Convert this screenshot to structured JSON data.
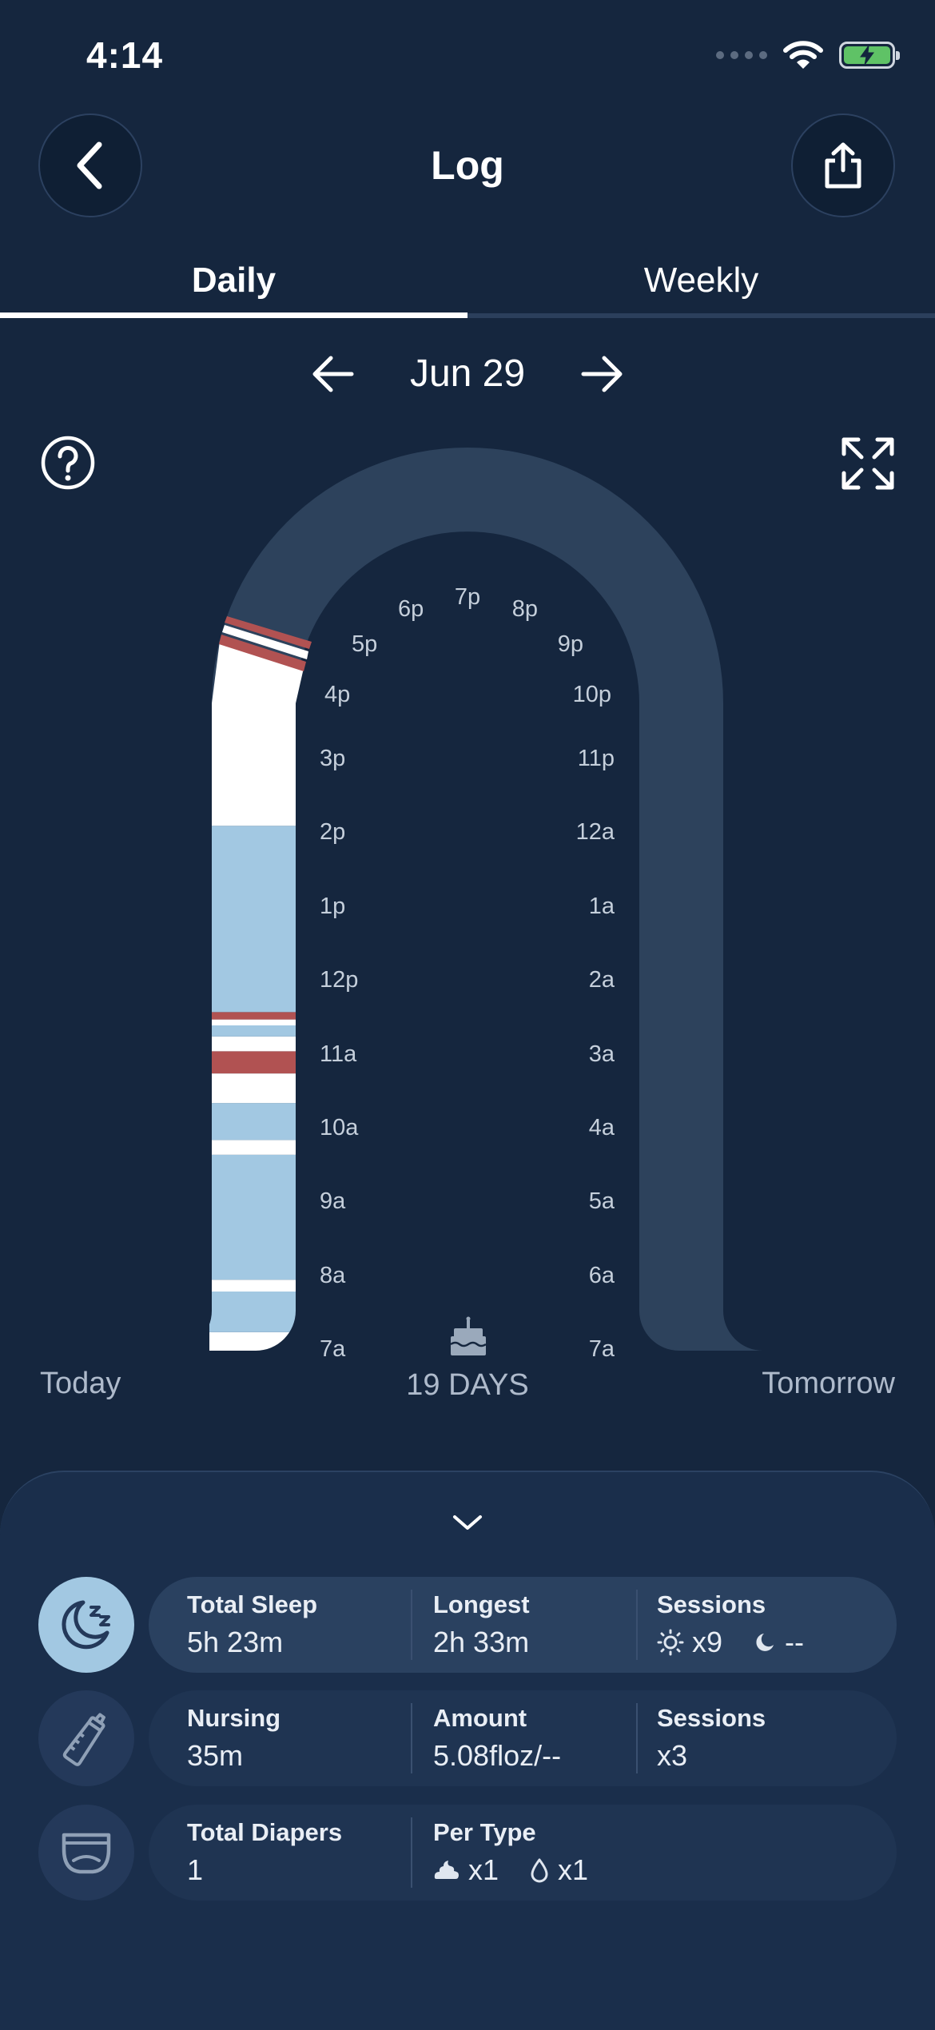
{
  "status_bar": {
    "time": "4:14"
  },
  "header": {
    "title": "Log"
  },
  "tabs": [
    {
      "label": "Daily",
      "active": true
    },
    {
      "label": "Weekly",
      "active": false
    }
  ],
  "date_nav": {
    "date": "Jun 29"
  },
  "arch_chart": {
    "left_hour_labels": [
      "7a",
      "8a",
      "9a",
      "10a",
      "11a",
      "12p",
      "1p",
      "2p",
      "3p",
      "4p",
      "5p",
      "6p"
    ],
    "top_hour_label": "7p",
    "right_hour_labels": [
      "8p",
      "9p",
      "10p",
      "11p",
      "12a",
      "1a",
      "2a",
      "3a",
      "4a",
      "5a",
      "6a",
      "7a"
    ],
    "age_text": "19 DAYS",
    "today_label": "Today",
    "tomorrow_label": "Tomorrow",
    "colors": {
      "sleep": "#a2c8e2",
      "awake": "#ffffff",
      "feeding": "#b15252",
      "track": "#2d425c"
    },
    "segments_hours_from_7a": [
      {
        "start": 0.0,
        "end": 0.25,
        "type": "awake"
      },
      {
        "start": 0.25,
        "end": 0.8,
        "type": "sleep"
      },
      {
        "start": 0.8,
        "end": 0.96,
        "type": "awake"
      },
      {
        "start": 0.96,
        "end": 2.65,
        "type": "sleep"
      },
      {
        "start": 2.65,
        "end": 2.85,
        "type": "awake"
      },
      {
        "start": 2.85,
        "end": 3.35,
        "type": "sleep"
      },
      {
        "start": 3.35,
        "end": 3.75,
        "type": "awake"
      },
      {
        "start": 3.75,
        "end": 4.05,
        "type": "feeding"
      },
      {
        "start": 4.05,
        "end": 4.25,
        "type": "awake"
      },
      {
        "start": 4.25,
        "end": 4.4,
        "type": "sleep"
      },
      {
        "start": 4.4,
        "end": 4.48,
        "type": "awake"
      },
      {
        "start": 4.48,
        "end": 4.58,
        "type": "feeding"
      },
      {
        "start": 4.58,
        "end": 7.1,
        "type": "sleep"
      },
      {
        "start": 7.1,
        "end": 8.85,
        "type": "awake"
      },
      {
        "start": 8.85,
        "end": 9.05,
        "type": "feeding"
      },
      {
        "start": 9.05,
        "end": 9.3,
        "type": "awake"
      },
      {
        "start": 9.3,
        "end": 9.5,
        "type": "feeding"
      },
      {
        "start": 9.5,
        "end": 9.75,
        "type": "awake"
      },
      {
        "start": 9.75,
        "end": 9.85,
        "type": "feeding"
      }
    ]
  },
  "summary": {
    "sleep": {
      "icon": "sleep-moon-icon",
      "total_label": "Total Sleep",
      "total_value": "5h 23m",
      "longest_label": "Longest",
      "longest_value": "2h 33m",
      "sessions_label": "Sessions",
      "day_sessions": "x9",
      "night_sessions": "--"
    },
    "nursing": {
      "icon": "bottle-icon",
      "label": "Nursing",
      "value": "35m",
      "amount_label": "Amount",
      "amount_value": "5.08floz/--",
      "sessions_label": "Sessions",
      "sessions_value": "x3"
    },
    "diapers": {
      "icon": "diaper-icon",
      "total_label": "Total Diapers",
      "total_value": "1",
      "per_type_label": "Per Type",
      "poop_count": "x1",
      "wet_count": "x1"
    }
  }
}
